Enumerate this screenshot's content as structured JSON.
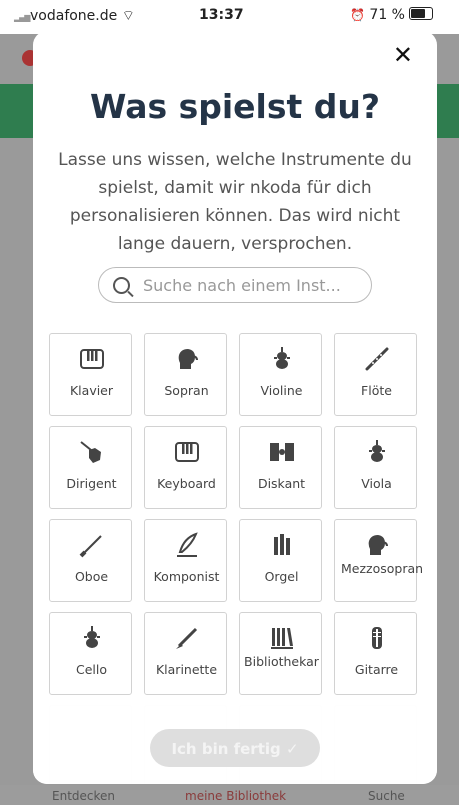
{
  "status_bar": {
    "carrier": "vodafone.de",
    "time": "13:37",
    "battery": "71 %"
  },
  "background": {
    "tabs": [
      "Entdecken",
      "meine Bibliothek",
      "Suche"
    ]
  },
  "modal": {
    "close": "✕",
    "title": "Was spielst du?",
    "subtitle": "Lasse uns wissen, welche Instrumente du spielst, damit wir nkoda für dich personalisieren können. Das wird nicht lange dauern, versprochen.",
    "search_placeholder": "Suche nach einem Inst...",
    "instruments": [
      {
        "label": "Klavier",
        "icon": "piano-icon"
      },
      {
        "label": "Sopran",
        "icon": "singer-icon"
      },
      {
        "label": "Violine",
        "icon": "string-icon"
      },
      {
        "label": "Flöte",
        "icon": "flute-icon"
      },
      {
        "label": "Dirigent",
        "icon": "conductor-hand-icon"
      },
      {
        "label": "Keyboard",
        "icon": "keyboard-icon"
      },
      {
        "label": "Diskant",
        "icon": "diskant-icon"
      },
      {
        "label": "Viola",
        "icon": "string-icon"
      },
      {
        "label": "Oboe",
        "icon": "oboe-icon"
      },
      {
        "label": "Komponist",
        "icon": "quill-icon"
      },
      {
        "label": "Orgel",
        "icon": "organ-icon"
      },
      {
        "label": "Mezzosopran",
        "icon": "singer-icon"
      },
      {
        "label": "Cello",
        "icon": "string-icon"
      },
      {
        "label": "Klarinette",
        "icon": "clarinet-icon"
      },
      {
        "label": "Bibliothekar",
        "icon": "library-icon"
      },
      {
        "label": "Gitarre",
        "icon": "guitar-icon"
      }
    ],
    "done_button": "Ich bin fertig ✓"
  },
  "colors": {
    "title": "#243447",
    "green_bar": "#2f7d4f"
  }
}
